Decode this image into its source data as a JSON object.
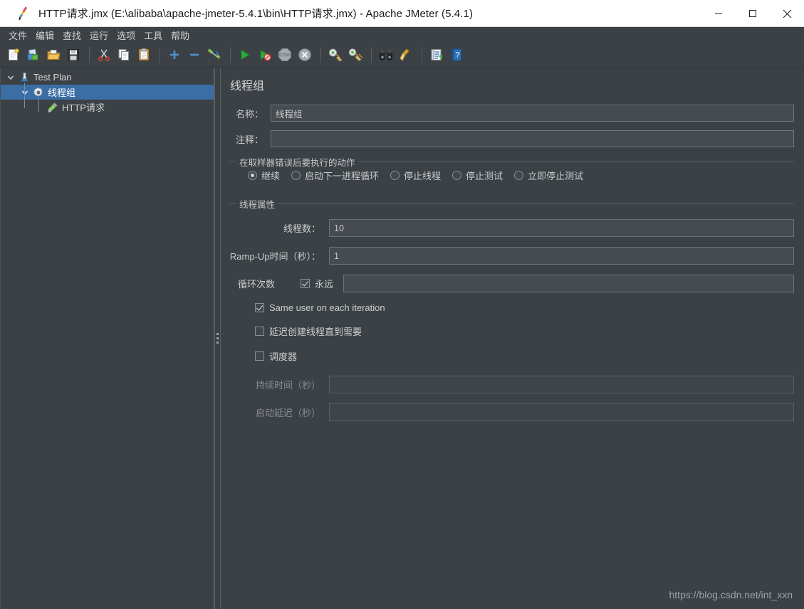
{
  "window": {
    "title": "HTTP请求.jmx (E:\\alibaba\\apache-jmeter-5.4.1\\bin\\HTTP请求.jmx) - Apache JMeter (5.4.1)",
    "app_icon": "jmeter-feather-icon",
    "controls": {
      "minimize": "minimize-icon",
      "maximize": "maximize-icon",
      "close": "close-icon"
    }
  },
  "menubar": {
    "items": [
      {
        "label": "文件",
        "name": "menu-file"
      },
      {
        "label": "编辑",
        "name": "menu-edit"
      },
      {
        "label": "查找",
        "name": "menu-search"
      },
      {
        "label": "运行",
        "name": "menu-run"
      },
      {
        "label": "选项",
        "name": "menu-options"
      },
      {
        "label": "工具",
        "name": "menu-tools"
      },
      {
        "label": "帮助",
        "name": "menu-help"
      }
    ]
  },
  "toolbar": {
    "buttons": [
      {
        "icon": "new-document-icon",
        "name": "new-test-plan-button"
      },
      {
        "icon": "templates-icon",
        "name": "templates-button"
      },
      {
        "icon": "open-folder-icon",
        "name": "open-button"
      },
      {
        "icon": "save-floppy-icon",
        "name": "save-button"
      },
      {
        "sep": true
      },
      {
        "icon": "scissors-cut-icon",
        "name": "cut-button"
      },
      {
        "icon": "copy-pages-icon",
        "name": "copy-button"
      },
      {
        "icon": "clipboard-paste-icon",
        "name": "paste-button"
      },
      {
        "sep": true
      },
      {
        "icon": "plus-expand-icon",
        "name": "expand-all-button"
      },
      {
        "icon": "minus-collapse-icon",
        "name": "collapse-all-button"
      },
      {
        "icon": "toggle-element-icon",
        "name": "toggle-button"
      },
      {
        "sep": true
      },
      {
        "icon": "play-start-icon",
        "name": "start-button"
      },
      {
        "icon": "play-no-pause-icon",
        "name": "start-no-pauses-button"
      },
      {
        "icon": "stop-sign-icon",
        "name": "stop-button"
      },
      {
        "icon": "shutdown-x-icon",
        "name": "shutdown-button"
      },
      {
        "sep": true
      },
      {
        "icon": "clear-broom-icon",
        "name": "clear-button"
      },
      {
        "icon": "clear-all-broom-icon",
        "name": "clear-all-button"
      },
      {
        "sep": true
      },
      {
        "icon": "binoculars-search-icon",
        "name": "search-button"
      },
      {
        "icon": "broom-reset-icon",
        "name": "reset-search-button"
      },
      {
        "sep": true
      },
      {
        "icon": "function-helper-icon",
        "name": "function-helper-button"
      },
      {
        "icon": "help-book-icon",
        "name": "help-button"
      }
    ]
  },
  "tree": {
    "nodes": [
      {
        "label": "Test Plan",
        "icon": "test-plan-icon",
        "depth": 0,
        "expanded": true,
        "selected": false,
        "name": "tree-node-test-plan"
      },
      {
        "label": "线程组",
        "icon": "thread-group-gear-icon",
        "depth": 1,
        "expanded": true,
        "selected": true,
        "name": "tree-node-thread-group"
      },
      {
        "label": "HTTP请求",
        "icon": "http-sampler-pen-icon",
        "depth": 2,
        "expanded": false,
        "selected": false,
        "name": "tree-node-http-request"
      }
    ]
  },
  "main": {
    "panel_title": "线程组",
    "name_label": "名称：",
    "name_value": "线程组",
    "comment_label": "注释：",
    "comment_value": "",
    "error_action": {
      "legend": "在取样器错误后要执行的动作",
      "options": [
        {
          "label": "继续",
          "selected": true,
          "name": "radio-continue"
        },
        {
          "label": "启动下一进程循环",
          "selected": false,
          "name": "radio-start-next-loop"
        },
        {
          "label": "停止线程",
          "selected": false,
          "name": "radio-stop-thread"
        },
        {
          "label": "停止测试",
          "selected": false,
          "name": "radio-stop-test"
        },
        {
          "label": "立即停止测试",
          "selected": false,
          "name": "radio-stop-test-now"
        }
      ]
    },
    "thread_properties": {
      "legend": "线程属性",
      "num_threads_label": "线程数：",
      "num_threads_value": "10",
      "ramp_up_label": "Ramp-Up时间（秒）：",
      "ramp_up_value": "1",
      "loop_count_label": "循环次数",
      "loop_forever_label": "永远",
      "loop_forever_checked": true,
      "loop_count_value": "",
      "same_user_label": "Same user on each iteration",
      "same_user_checked": true,
      "delayed_start_label": "延迟创建线程直到需要",
      "delayed_start_checked": false,
      "scheduler_label": "调度器",
      "scheduler_checked": false,
      "duration_label": "持续时间（秒）",
      "duration_value": "",
      "startup_delay_label": "启动延迟（秒）",
      "startup_delay_value": ""
    }
  },
  "watermark": "https://blog.csdn.net/int_xxn",
  "colors": {
    "window_bg": "#3c4145",
    "titlebar_bg": "#ffffff",
    "selection_blue": "#3a6ea5",
    "field_bg": "#464b4f",
    "text": "#c9cdd0"
  }
}
